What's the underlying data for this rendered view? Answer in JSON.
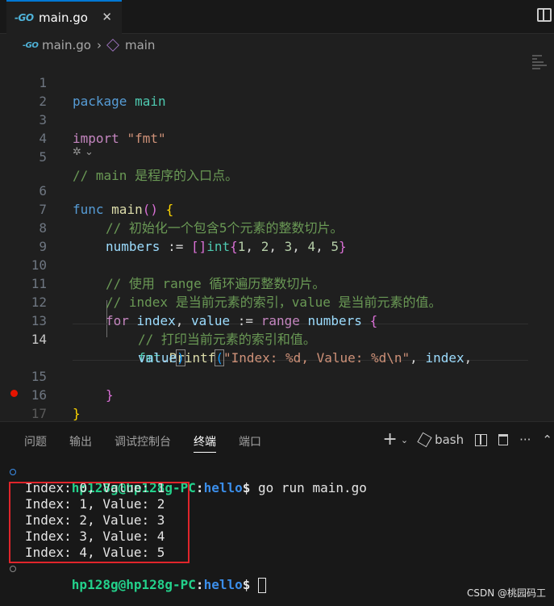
{
  "tab": {
    "icon": "go-icon",
    "icon_text": "-GO",
    "title": "main.go",
    "close": "✕"
  },
  "breadcrumb": {
    "file": "main.go",
    "sep": "›",
    "symbol": "main"
  },
  "editor": {
    "lines": {
      "l1": "1",
      "l2": "2",
      "l3": "3",
      "l4": "4",
      "l5": "5",
      "l6": "6",
      "l7": "7",
      "l8": "8",
      "l9": "9",
      "l10": "10",
      "l11": "11",
      "l12": "12",
      "l13": "13",
      "l14": "14",
      "l15": "15",
      "l16": "16",
      "l17": "17"
    },
    "code": {
      "package_kw": "package",
      "package_name": "main",
      "import_kw": "import",
      "import_path": "\"fmt\"",
      "comment_main": "// main 是程序的入口点。",
      "func_kw": "func",
      "func_name": "main",
      "func_parens": "()",
      "brace_open": "{",
      "comment_init": "// 初始化一个包含5个元素的整数切片。",
      "numbers_var": "numbers",
      "assign_op": " := ",
      "slice_brackets": "[]",
      "int_type": "int",
      "lit_open": "{",
      "n1": "1",
      "n2": "2",
      "n3": "3",
      "n4": "4",
      "n5": "5",
      "lit_close": "}",
      "comma": ", ",
      "comment_range": "// 使用 range 循环遍历整数切片。",
      "comment_index": "// index 是当前元素的索引，value 是当前元素的值。",
      "for_kw": "for",
      "index_var": "index",
      "value_var": "value",
      "range_kw": "range",
      "comment_print": "// 打印当前元素的索引和值。",
      "fmt_pkg": "fmt",
      "dot": ".",
      "printf_fn": "Printf",
      "paren_open": "(",
      "paren_close": ")",
      "format_str": "\"Index: %d, Value: %d\\n\"",
      "brace_close": "}"
    },
    "codelens_icon": "copilot-icon",
    "codelens_chevron": "⌄"
  },
  "panel": {
    "tabs": [
      "问题",
      "输出",
      "调试控制台",
      "终端",
      "端口"
    ],
    "active_tab": "终端",
    "actions": {
      "new_terminal": "+",
      "dropdown": "⌄",
      "shell": "bash",
      "more": "···",
      "collapse": "⌃"
    }
  },
  "terminal": {
    "user": "hp128g@hp128g-PC",
    "colon": ":",
    "dir": "hello",
    "dollar": "$",
    "command": " go run main.go",
    "output": [
      "Index: 0, Value: 1",
      "Index: 1, Value: 2",
      "Index: 2, Value: 3",
      "Index: 3, Value: 4",
      "Index: 4, Value: 5"
    ]
  },
  "watermark": "CSDN @桃园码工",
  "colors": {
    "accent": "#0078d4",
    "highlight_box": "#e0252b",
    "prompt_user": "#23d18b",
    "prompt_dir": "#3b8eea"
  }
}
